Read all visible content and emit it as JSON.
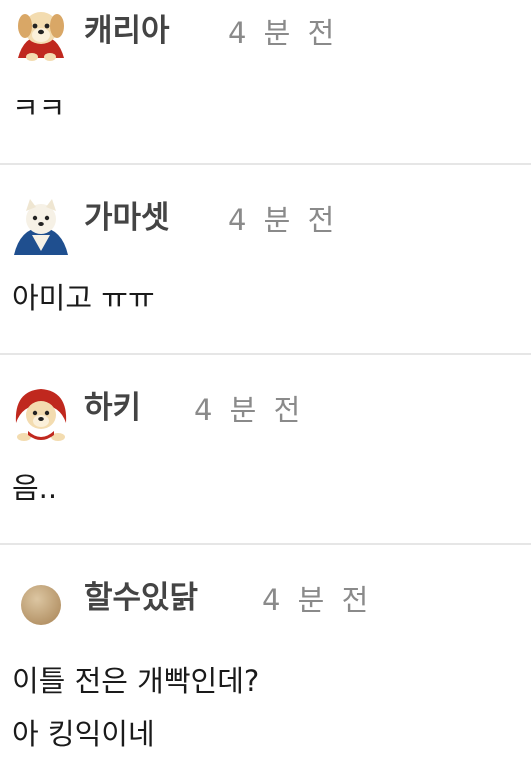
{
  "comments": [
    {
      "nickname": "캐리아",
      "time": "4 분 전",
      "text_lines": [
        "ㅋㅋ"
      ],
      "avatar": "puppy-red-cape-avatar"
    },
    {
      "nickname": "가마셋",
      "time": "4 분 전",
      "text_lines": [
        "아미고 ㅠㅠ"
      ],
      "avatar": "white-dog-blue-cape-avatar"
    },
    {
      "nickname": "하키",
      "time": "4 분 전",
      "text_lines": [
        "음.."
      ],
      "avatar": "puppy-red-hood-avatar"
    },
    {
      "nickname": "할수있닭",
      "time": "4 분 전",
      "text_lines": [
        "이틀 전은 개빡인데?",
        "아 킹익이네"
      ],
      "avatar": "beige-circle-avatar"
    }
  ],
  "colors": {
    "nickname": "#444444",
    "time": "#8a8a8a",
    "text": "#1a1a1a",
    "divider": "#e6e6e6",
    "red_cape": "#c0281e",
    "blue_cape": "#1f4f8f",
    "beige": "#c9ae86"
  }
}
